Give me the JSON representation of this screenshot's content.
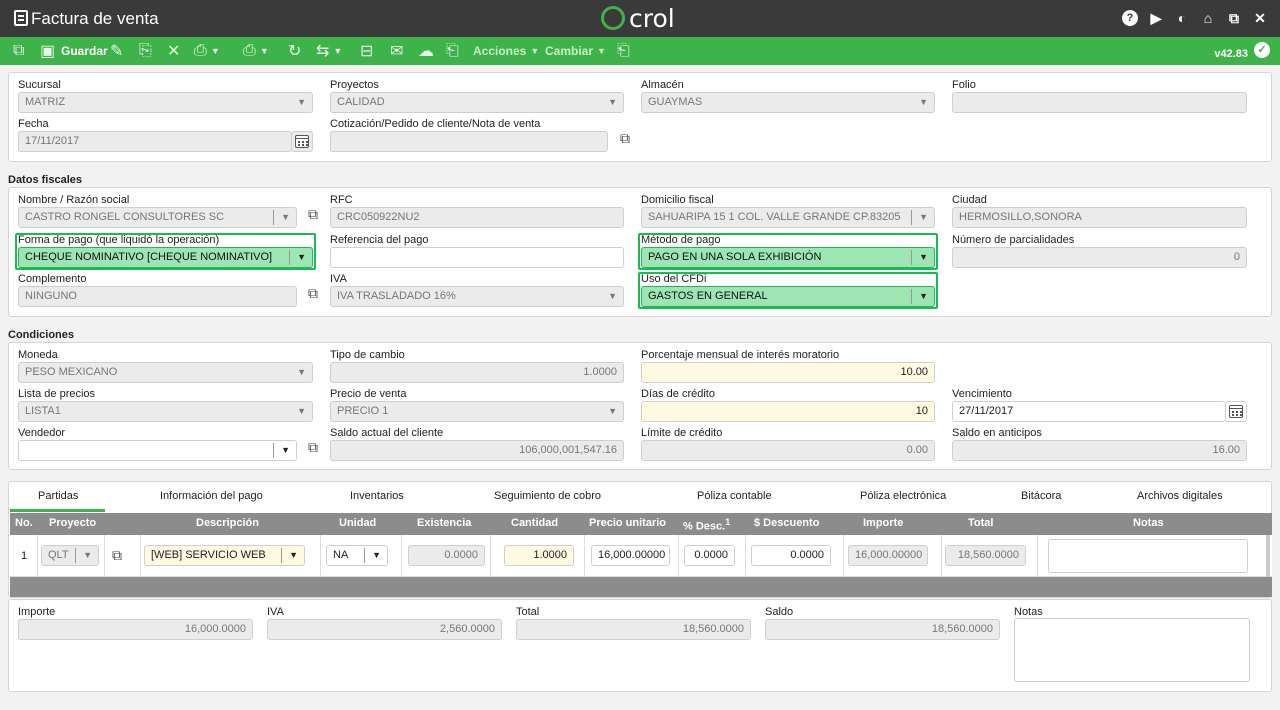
{
  "title_bar": {
    "title": "Factura de venta",
    "logo": "crol"
  },
  "toolbar": {
    "save_label": "Guardar",
    "actions_label": "Acciones",
    "change_label": "Cambiar",
    "version": "v42.83"
  },
  "header": {
    "sucursal": {
      "label": "Sucursal",
      "value": "MATRIZ"
    },
    "proyectos": {
      "label": "Proyectos",
      "value": "CALIDAD"
    },
    "almacen": {
      "label": "Almacén",
      "value": "GUAYMAS"
    },
    "folio": {
      "label": "Folio",
      "value": ""
    },
    "fecha": {
      "label": "Fecha",
      "value": "17/11/2017"
    },
    "cotizacion": {
      "label": "Cotización/Pedido de cliente/Nota de venta",
      "value": ""
    }
  },
  "fiscal": {
    "section_title": "Datos fiscales",
    "nombre": {
      "label": "Nombre / Razón social",
      "value": "CASTRO RONGEL CONSULTORES SC"
    },
    "rfc": {
      "label": "RFC",
      "value": "CRC050922NU2"
    },
    "domicilio": {
      "label": "Domicilio fiscal",
      "value": "SAHUARIPA 15 1 COL. VALLE GRANDE CP.83205"
    },
    "ciudad": {
      "label": "Ciudad",
      "value": "HERMOSILLO,SONORA"
    },
    "forma_pago": {
      "label": "Forma de pago (que liquidó la operación)",
      "value": "CHEQUE NOMINATIVO [CHEQUE NOMINATIVO]"
    },
    "referencia": {
      "label": "Referencia del pago",
      "value": ""
    },
    "metodo_pago": {
      "label": "Método de pago",
      "value": "PAGO EN UNA SOLA EXHIBICIÓN"
    },
    "parcialidades": {
      "label": "Número de parcialidades",
      "value": "0"
    },
    "complemento": {
      "label": "Complemento",
      "value": "NINGUNO"
    },
    "iva": {
      "label": "IVA",
      "value": "IVA TRASLADADO 16%"
    },
    "uso_cfdi": {
      "label": "Uso del CFDi",
      "value": "GASTOS EN GENERAL"
    }
  },
  "conditions": {
    "section_title": "Condiciones",
    "moneda": {
      "label": "Moneda",
      "value": "PESO MEXICANO"
    },
    "tipo_cambio": {
      "label": "Tipo de cambio",
      "value": "1.0000"
    },
    "interes": {
      "label": "Porcentaje mensual de interés moratorio",
      "value": "10.00"
    },
    "lista_precios": {
      "label": "Lista de precios",
      "value": "LISTA1"
    },
    "precio_venta": {
      "label": "Precio de venta",
      "value": "PRECIO 1"
    },
    "dias_credito": {
      "label": "Días de crédito",
      "value": "10"
    },
    "vencimiento": {
      "label": "Vencimiento",
      "value": "27/11/2017"
    },
    "vendedor": {
      "label": "Vendedor",
      "value": ""
    },
    "saldo_cliente": {
      "label": "Saldo actual del cliente",
      "value": "106,000,001,547.16"
    },
    "limite_credito": {
      "label": "Límite de crédito",
      "value": "0.00"
    },
    "saldo_anticipos": {
      "label": "Saldo en anticipos",
      "value": "16.00"
    }
  },
  "tabs": [
    "Partidas",
    "Información del pago",
    "Inventarios",
    "Seguimiento de cobro",
    "Póliza contable",
    "Póliza electrónica",
    "Bitácora",
    "Archivos digitales"
  ],
  "grid": {
    "columns": [
      "No.",
      "Proyecto",
      "Descripción",
      "Unidad",
      "Existencia",
      "Cantidad",
      "Precio unitario",
      "% Desc.",
      "$ Descuento",
      "Importe",
      "Total",
      "Notas"
    ],
    "desc_superscript": "1",
    "row": {
      "no": "1",
      "proyecto": "QLT",
      "descripcion": "[WEB] SERVICIO WEB",
      "unidad": "NA",
      "existencia": "0.0000",
      "cantidad": "1.0000",
      "precio": "16,000.00000",
      "desc_pct": "0.0000",
      "descuento": "0.0000",
      "importe": "16,000.00000",
      "total": "18,560.0000",
      "notas": ""
    }
  },
  "totals": {
    "importe": {
      "label": "Importe",
      "value": "16,000.0000"
    },
    "iva": {
      "label": "IVA",
      "value": "2,560.0000"
    },
    "total": {
      "label": "Total",
      "value": "18,560.0000"
    },
    "saldo": {
      "label": "Saldo",
      "value": "18,560.0000"
    },
    "notas": {
      "label": "Notas",
      "value": ""
    }
  }
}
